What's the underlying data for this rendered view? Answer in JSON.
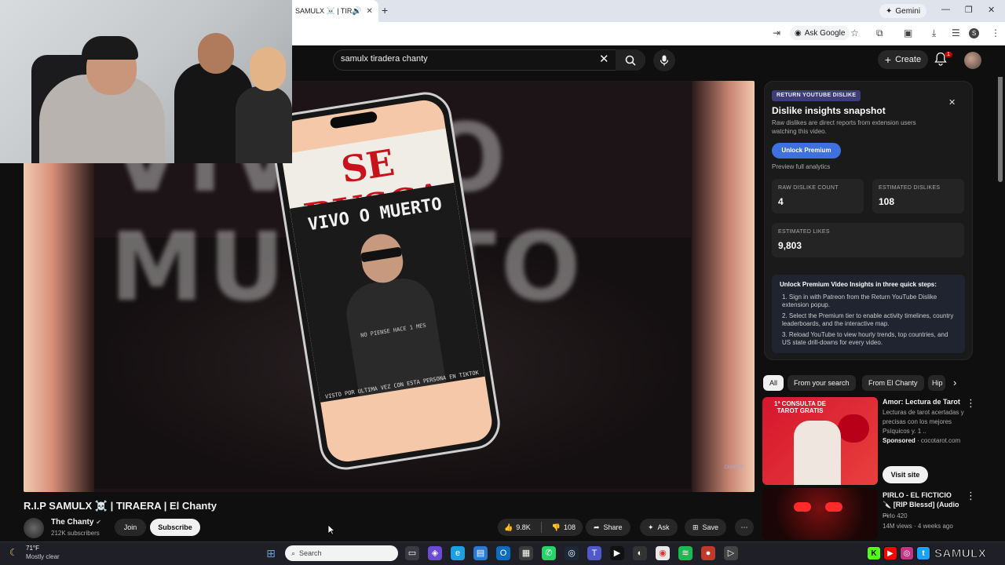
{
  "browser": {
    "tab_title": "SAMULX ☠️ | TIRAE",
    "gemini_label": "Gemini",
    "ask_google_label": "Ask Google",
    "profile_initial": "S"
  },
  "header": {
    "search_value": "samulx tiradera chanty",
    "create_label": "Create",
    "notif_count": "1"
  },
  "video": {
    "poster_title": "SE BUSCA",
    "poster_subtitle": "VIVO O MUERTO",
    "poster_note": "NO PIENSE HACE 1 MES",
    "poster_caption": "VISTO POR ULTIMA VEZ CON ESTA PERSONA EN TIKTOK",
    "background_text": "VIVO O MUERTO",
    "watermark": "CHANTY",
    "title": "R.I.P SAMULX ☠️ | TIRAERA | El Chanty",
    "channel": "The Chanty",
    "subscribers": "212K subscribers",
    "join_label": "Join",
    "subscribe_label": "Subscribe",
    "likes": "9.8K",
    "dislikes": "108",
    "share_label": "Share",
    "ask_label": "Ask",
    "save_label": "Save"
  },
  "dislike_panel": {
    "badge": "RETURN YOUTUBE DISLIKE",
    "title": "Dislike insights snapshot",
    "description": "Raw dislikes are direct reports from extension users watching this video.",
    "unlock_label": "Unlock Premium",
    "preview_label": "Preview full analytics",
    "raw_label": "RAW DISLIKE COUNT",
    "raw_value": "4",
    "est_dislikes_label": "ESTIMATED DISLIKES",
    "est_dislikes_value": "108",
    "est_likes_label": "ESTIMATED LIKES",
    "est_likes_value": "9,803",
    "steps_title": "Unlock Premium Video Insights in three quick steps:",
    "steps": [
      "1. Sign in with Patreon from the Return YouTube Dislike extension popup.",
      "2. Select the Premium tier to enable activity timelines, country leaderboards, and the interactive map.",
      "3. Reload YouTube to view hourly trends, top countries, and US state drill-downs for every video."
    ]
  },
  "chips": [
    "All",
    "From your search",
    "From El Chanty",
    "Hip"
  ],
  "sidebar": {
    "ad": {
      "thumb_text": "1ª CONSULTA DE TAROT GRATIS",
      "title": "Amor: Lectura de Tarot",
      "description": "Lecturas de tarot acertadas y precisas con los mejores Psíquicos y. 1 ..",
      "sponsored": "Sponsored",
      "domain": "cocotarot.com",
      "visit_label": "Visit site"
    },
    "video2": {
      "title": "PIRLO - EL FICTICIO 🔪 [RIP Blessd] (Audio ...",
      "channel": "Pirlo 420",
      "meta": "14M views · 4 weeks ago"
    }
  },
  "taskbar": {
    "temp": "71°F",
    "weather": "Mostly clear",
    "search_placeholder": "Search",
    "handle": "SAMULX"
  }
}
